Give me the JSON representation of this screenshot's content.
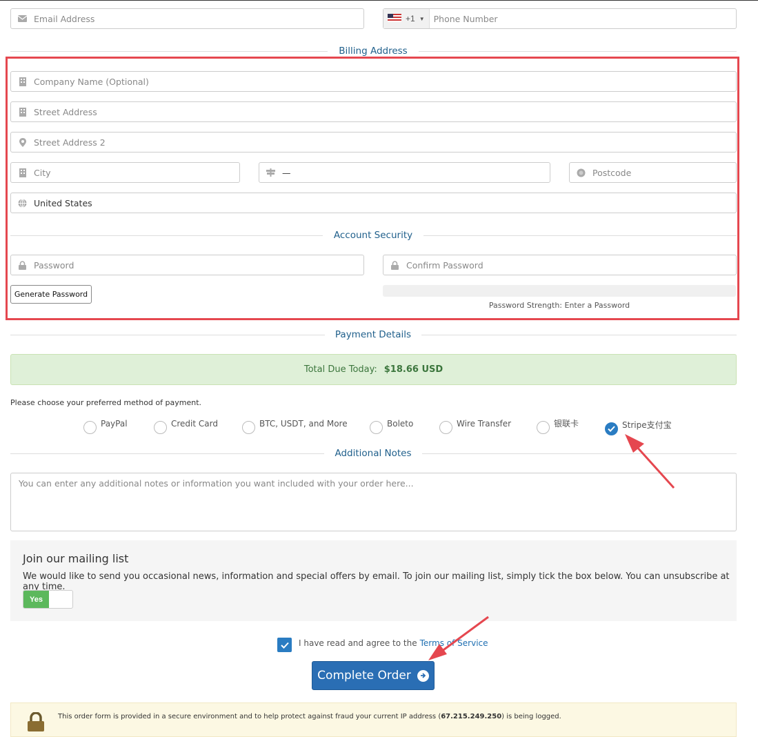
{
  "contact": {
    "email_placeholder": "Email Address",
    "phone_code": "+1",
    "phone_placeholder": "Phone Number"
  },
  "billing": {
    "title": "Billing Address",
    "company_placeholder": "Company Name (Optional)",
    "street_placeholder": "Street Address",
    "street2_placeholder": "Street Address 2",
    "city_placeholder": "City",
    "state_value": "—",
    "postcode_placeholder": "Postcode",
    "country_value": "United States"
  },
  "security": {
    "title": "Account Security",
    "password_placeholder": "Password",
    "confirm_placeholder": "Confirm Password",
    "generate_label": "Generate Password",
    "strength_text": "Password Strength: Enter a Password"
  },
  "payment": {
    "title": "Payment Details",
    "total_label": "Total Due Today:",
    "total_value": "$18.66 USD",
    "choose_text": "Please choose your preferred method of payment.",
    "methods": [
      {
        "label": "PayPal",
        "selected": false
      },
      {
        "label": "Credit Card",
        "selected": false
      },
      {
        "label": "BTC, USDT, and More",
        "selected": false
      },
      {
        "label": "Boleto",
        "selected": false
      },
      {
        "label": "Wire Transfer",
        "selected": false
      },
      {
        "label": "银联卡",
        "selected": false
      },
      {
        "label": "Stripe支付宝",
        "selected": true
      }
    ]
  },
  "notes": {
    "title": "Additional Notes",
    "placeholder": "You can enter any additional notes or information you want included with your order here..."
  },
  "mailing": {
    "title": "Join our mailing list",
    "text": "We would like to send you occasional news, information and special offers by email. To join our mailing list, simply tick the box below. You can unsubscribe at any time.",
    "toggle_label": "Yes"
  },
  "tos": {
    "prefix": "I have read and agree to the",
    "link": "Terms of Service"
  },
  "order": {
    "button_label": "Complete Order"
  },
  "secure": {
    "text_before": "This order form is provided in a secure environment and to help protect against fraud your current IP address (",
    "ip": "67.215.249.250",
    "text_after": ") is being logged."
  },
  "colors": {
    "accent": "#2a7cc2",
    "section_title": "#1f5f8b",
    "annotation": "#e5474f",
    "success_bg": "#dff0d8"
  }
}
